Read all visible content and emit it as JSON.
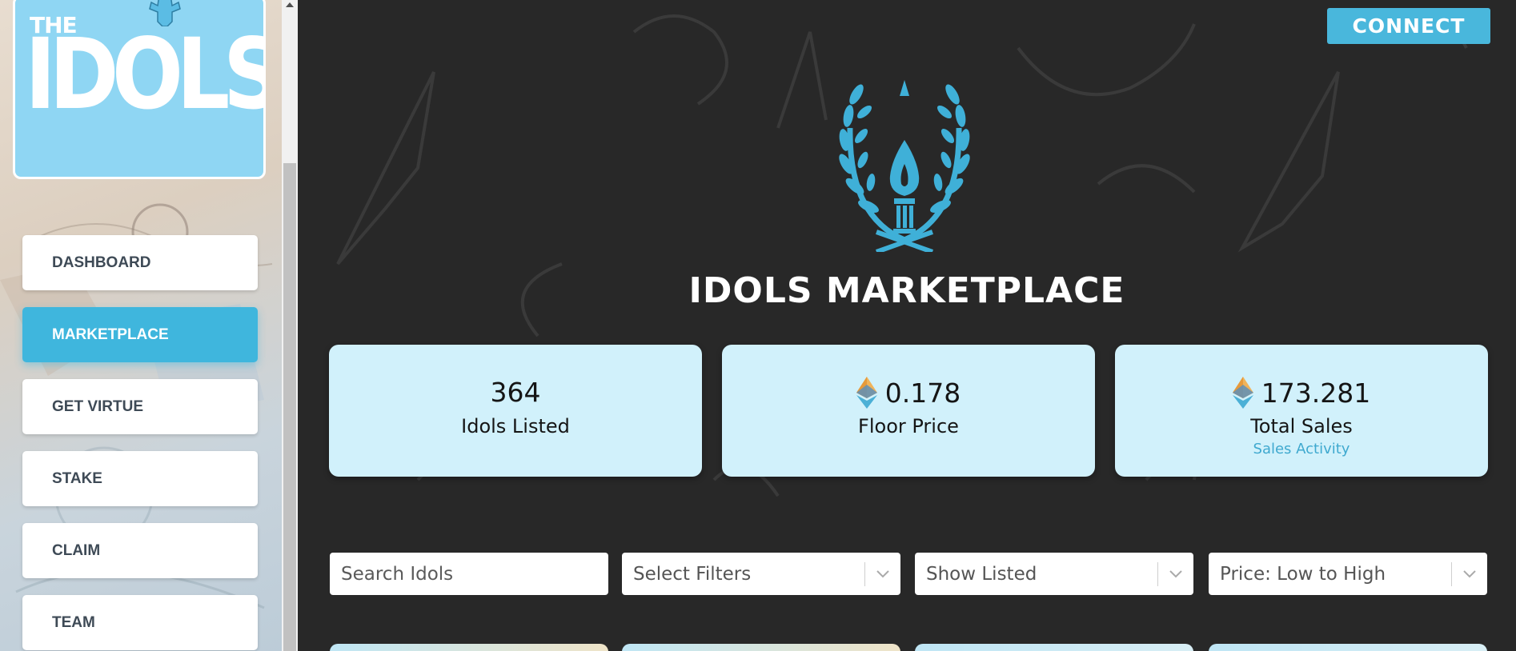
{
  "sidebar": {
    "logo": {
      "the": "THE",
      "idols": "IDOLS"
    },
    "items": [
      {
        "label": "DASHBOARD",
        "active": false
      },
      {
        "label": "MARKETPLACE",
        "active": true
      },
      {
        "label": "GET VIRTUE",
        "active": false
      },
      {
        "label": "STAKE",
        "active": false
      },
      {
        "label": "CLAIM",
        "active": false
      },
      {
        "label": "TEAM",
        "active": false
      }
    ]
  },
  "header": {
    "connect_label": "CONNECT"
  },
  "main": {
    "title": "IDOLS MARKETPLACE",
    "stats": [
      {
        "value": "364",
        "label": "Idols Listed",
        "icon": null
      },
      {
        "value": "0.178",
        "label": "Floor Price",
        "icon": "ethereum-icon"
      },
      {
        "value": "173.281",
        "label": "Total Sales",
        "icon": "ethereum-icon",
        "link": "Sales Activity"
      }
    ],
    "filters": {
      "search_placeholder": "Search Idols",
      "select_filters": "Select Filters",
      "show_listed": "Show Listed",
      "sort": "Price: Low to High"
    }
  },
  "colors": {
    "accent": "#3fb6dd",
    "background": "#282828",
    "card": "#d1f1fb",
    "logo_bg": "#8fd6f3"
  }
}
